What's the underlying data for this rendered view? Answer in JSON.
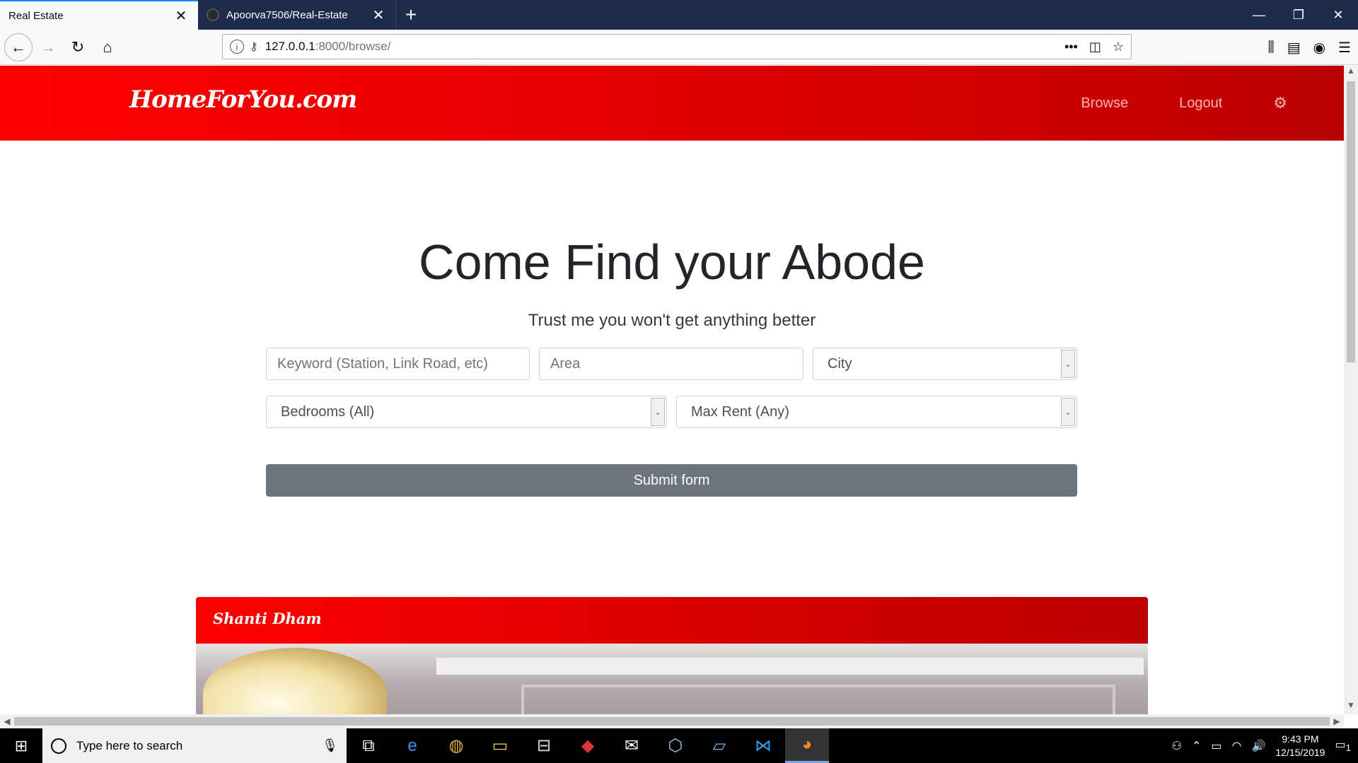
{
  "browser": {
    "tabs": [
      {
        "title": "Real Estate",
        "active": true
      },
      {
        "title": "Apoorva7506/Real-Estate",
        "active": false
      }
    ],
    "url_host": "127.0.0.1",
    "url_path": ":8000/browse/"
  },
  "site": {
    "logo": "HomeForYou.com",
    "nav": {
      "browse": "Browse",
      "logout": "Logout"
    }
  },
  "hero": {
    "title": "Come Find your Abode",
    "subtitle": "Trust me you won't get anything better"
  },
  "form": {
    "keyword_placeholder": "Keyword (Station, Link Road, etc)",
    "area_placeholder": "Area",
    "city_value": "City",
    "bedrooms_value": "Bedrooms (All)",
    "maxrent_value": "Max Rent (Any)",
    "submit_label": "Submit form"
  },
  "listing": {
    "title": "Shanti Dham"
  },
  "taskbar": {
    "search_placeholder": "Type here to search",
    "time": "9:43 PM",
    "date": "12/15/2019",
    "notification_count": "1"
  },
  "icons": [
    "github-icon",
    "close-icon",
    "plus-icon",
    "minimize-icon",
    "restore-icon",
    "back-arrow-icon",
    "forward-arrow-icon",
    "reload-icon",
    "home-icon",
    "info-icon",
    "key-icon",
    "more-icon",
    "pocket-icon",
    "star-icon",
    "library-icon",
    "sidebar-icon",
    "account-icon",
    "menu-icon",
    "gear-icon",
    "windows-icon",
    "microphone-icon",
    "task-view-icon",
    "edge-icon",
    "chrome-icon",
    "file-explorer-icon",
    "store-icon",
    "mail-icon",
    "vscode-icon",
    "firefox-icon"
  ],
  "colors": {
    "brand_red": "#ff0000",
    "brand_red_dark": "#b80000",
    "submit_gray": "#6c757d",
    "tab_strip": "#1f2b4d"
  }
}
